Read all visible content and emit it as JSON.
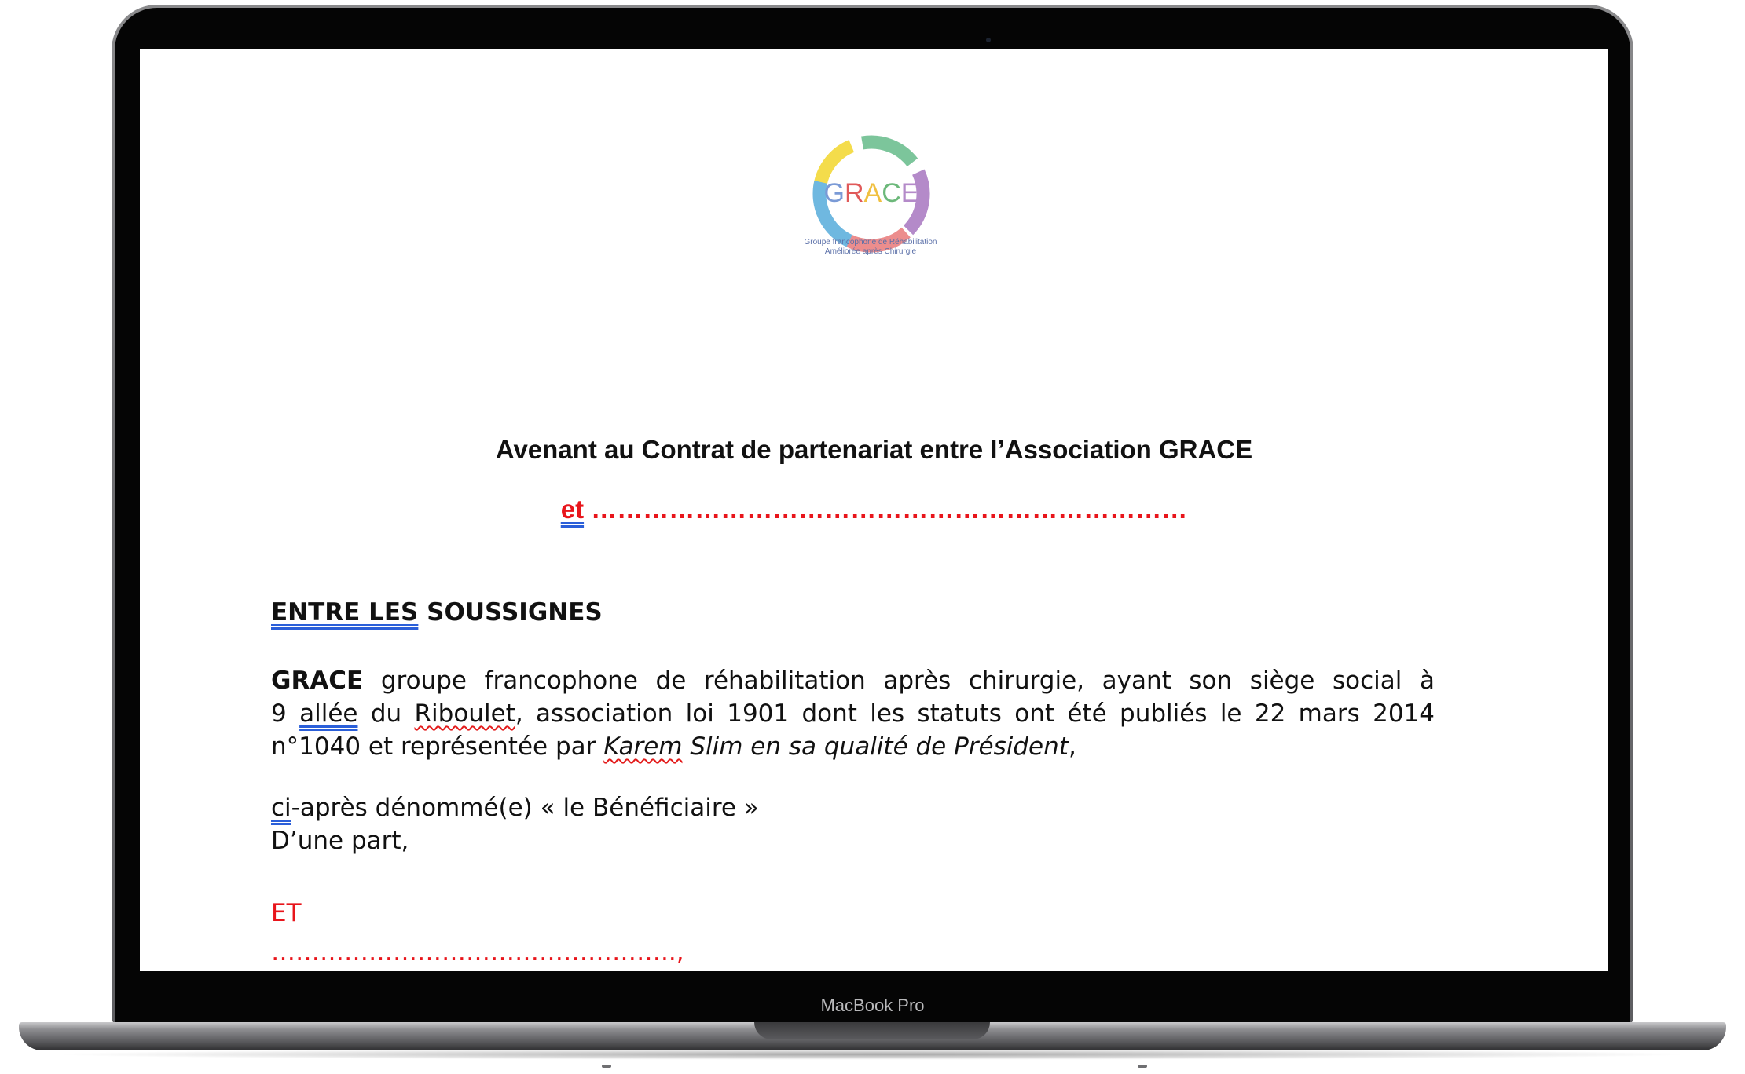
{
  "device": {
    "label": "MacBook Pro"
  },
  "document": {
    "logo": {
      "text": "GRACE",
      "caption_line1": "Groupe francophone de Réhabilitation",
      "caption_line2": "Améliorée après Chirurgie",
      "colors": {
        "yellow": "#f4dc4b",
        "green": "#7cc59b",
        "purple": "#b48ac9",
        "pink": "#ec8d8d",
        "blue": "#6fb8e0"
      }
    },
    "title": "Avenant au Contrat de partenariat entre l’Association GRACE",
    "subtitle": {
      "et": "et",
      "dots": " ……………………………………………………………"
    },
    "section_heading": {
      "part1": "ENTRE LES",
      "part2": " SOUSSIGNES"
    },
    "paragraph1": {
      "bold": "GRACE",
      "line1_rest": " groupe francophone de réhabilitation après chirurgie, ayant son siège social à",
      "line2_a": "9 ",
      "line2_allee": "allée",
      "line2_b": " du ",
      "line2_riboulet": "Riboulet",
      "line2_c": ", association loi 1901 dont les statuts ont été publiés le 22 mars 2014",
      "line3_a": "n°1040 et représentée par ",
      "line3_karem": "Karem",
      "line3_italic": " Slim en sa qualité de Président",
      "line3_end": ","
    },
    "paragraph2": {
      "ci": "ci",
      "line1_rest": "-après dénommé(e) « le Bénéficiaire »",
      "line2": "D’une part,"
    },
    "et_label": "ET",
    "dots_line": "…………………………………………..,"
  }
}
